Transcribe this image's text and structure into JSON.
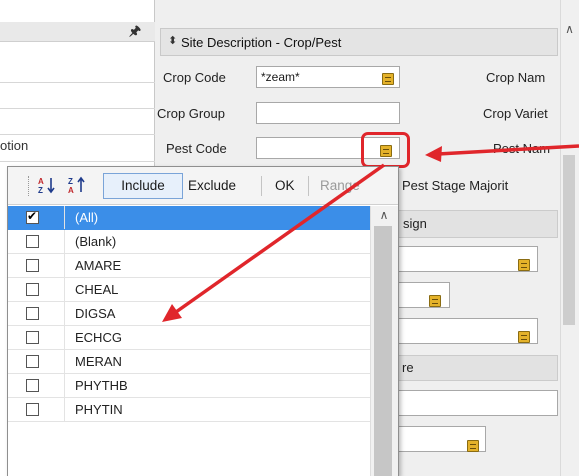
{
  "form": {
    "section_title": "Site Description - Crop/Pest",
    "fields": {
      "crop_code_label": "Crop Code",
      "crop_code_value": "*zeam*",
      "crop_group_label": "Crop Group",
      "crop_group_value": "",
      "pest_code_label": "Pest Code",
      "pest_code_value": "",
      "crop_name_label": "Crop Nam",
      "crop_variety_label": "Crop Variet",
      "pest_name_label": "Pest Nam",
      "pest_stage_label": "Pest Stage Majorit"
    },
    "behind_popup": {
      "sub_header_1": "sign",
      "sub_header_2": "re"
    }
  },
  "left_panel": {
    "partial_label": "otion"
  },
  "popup": {
    "toolbar": {
      "include_label": "Include",
      "exclude_label": "Exclude",
      "ok_label": "OK",
      "range_label": "Range",
      "sort_asc_icon": "sort-ascending-icon",
      "sort_desc_icon": "sort-descending-icon"
    },
    "items": [
      {
        "label": "(All)",
        "checked": true,
        "selected": true
      },
      {
        "label": "(Blank)",
        "checked": false
      },
      {
        "label": "AMARE",
        "checked": false
      },
      {
        "label": "CHEAL",
        "checked": false
      },
      {
        "label": "DIGSA",
        "checked": false
      },
      {
        "label": "ECHCG",
        "checked": false
      },
      {
        "label": "MERAN",
        "checked": false
      },
      {
        "label": "PHYTHB",
        "checked": false
      },
      {
        "label": "PHYTIN",
        "checked": false
      }
    ]
  },
  "colors": {
    "annotation_red": "#e0262b",
    "selection_blue": "#3b8ee8",
    "lookup_gold": "#e4b22a"
  }
}
